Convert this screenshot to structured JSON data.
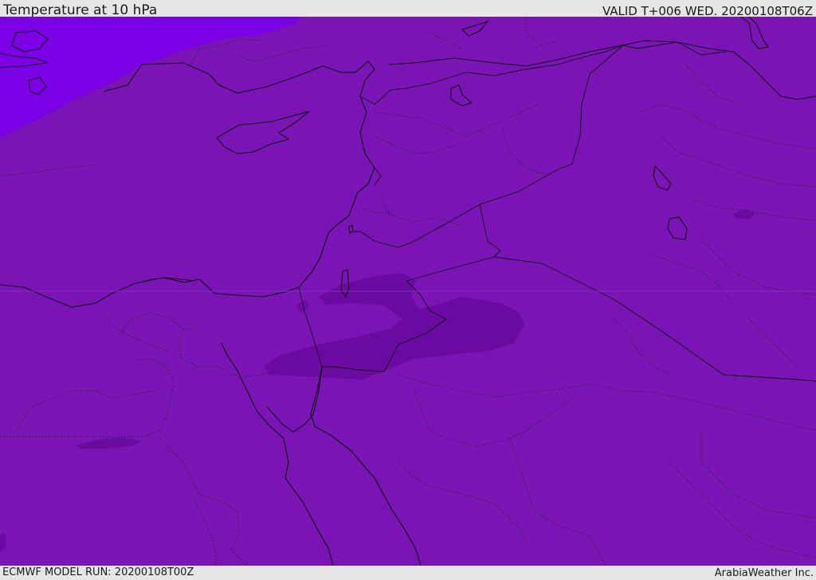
{
  "header": {
    "title": "Temperature at 10 hPa",
    "valid": "VALID T+006 WED. 20200108T06Z"
  },
  "footer": {
    "model_run": "ECMWF MODEL RUN: 20200108T00Z",
    "credit": "ArabiaWeather Inc."
  },
  "colors": {
    "base_field": "#7a14b4",
    "warm_field": "#7c00e6",
    "cold_field": "#6a0aa0",
    "line": "#111111"
  }
}
